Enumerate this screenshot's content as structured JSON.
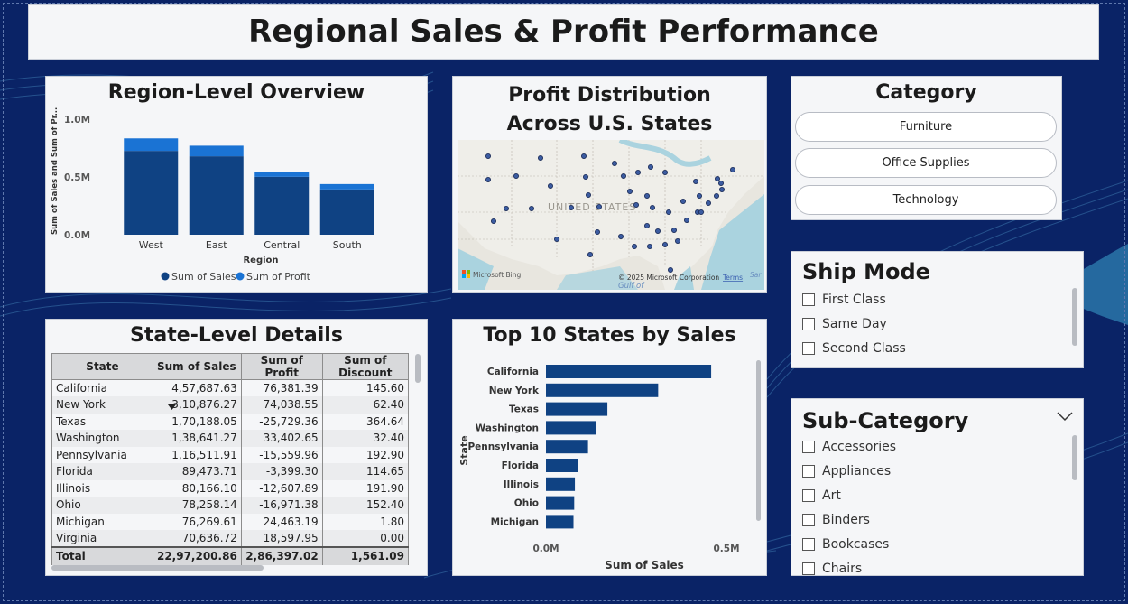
{
  "title": "Regional Sales & Profit Performance",
  "region_overview": {
    "title": "Region-Level Overview",
    "ylabel": "Sum of Sales and Sum of Pr...",
    "xlabel": "Region",
    "legend": [
      {
        "label": "Sum of Sales",
        "color": "#0f4283"
      },
      {
        "label": "Sum of Profit",
        "color": "#1a73d4"
      }
    ]
  },
  "map": {
    "title": "Profit Distribution Across U.S. States",
    "country_label": "UNITED STATES",
    "bing_label": "Microsoft Bing",
    "copyright": "© 2025 Microsoft Corporation",
    "terms": "Terms",
    "gulf_label": "Gulf of",
    "sar_label": "Sar"
  },
  "category": {
    "title": "Category",
    "options": [
      "Furniture",
      "Office Supplies",
      "Technology"
    ]
  },
  "ship_mode": {
    "title": "Ship Mode",
    "options": [
      "First Class",
      "Same Day",
      "Second Class"
    ]
  },
  "sub_category": {
    "title": "Sub-Category",
    "options": [
      "Accessories",
      "Appliances",
      "Art",
      "Binders",
      "Bookcases",
      "Chairs"
    ]
  },
  "state_details": {
    "title": "State-Level Details",
    "columns": [
      "State",
      "Sum of Sales",
      "Sum of Profit",
      "Sum of Discount"
    ],
    "rows": [
      [
        "California",
        "4,57,687.63",
        "76,381.39",
        "145.60"
      ],
      [
        "New York",
        "3,10,876.27",
        "74,038.55",
        "62.40"
      ],
      [
        "Texas",
        "1,70,188.05",
        "-25,729.36",
        "364.64"
      ],
      [
        "Washington",
        "1,38,641.27",
        "33,402.65",
        "32.40"
      ],
      [
        "Pennsylvania",
        "1,16,511.91",
        "-15,559.96",
        "192.90"
      ],
      [
        "Florida",
        "89,473.71",
        "-3,399.30",
        "114.65"
      ],
      [
        "Illinois",
        "80,166.10",
        "-12,607.89",
        "191.90"
      ],
      [
        "Ohio",
        "78,258.14",
        "-16,971.38",
        "152.40"
      ],
      [
        "Michigan",
        "76,269.61",
        "24,463.19",
        "1.80"
      ],
      [
        "Virginia",
        "70,636.72",
        "18,597.95",
        "0.00"
      ]
    ],
    "total": [
      "Total",
      "22,97,200.86",
      "2,86,397.02",
      "1,561.09"
    ]
  },
  "top10": {
    "title": "Top 10 States by Sales"
  },
  "chart_data": [
    {
      "type": "bar",
      "title": "Region-Level Overview",
      "xlabel": "Region",
      "ylabel": "Sum of Sales and Sum of Pr...",
      "categories": [
        "West",
        "East",
        "Central",
        "South"
      ],
      "series": [
        {
          "name": "Sum of Sales",
          "values": [
            725458,
            678781,
            501240,
            391722
          ],
          "color": "#0f4283"
        },
        {
          "name": "Sum of Profit",
          "values": [
            108418,
            91523,
            39706,
            46749
          ],
          "color": "#1a73d4"
        }
      ],
      "stacked": true,
      "ylim": [
        0,
        1000000
      ],
      "yticks": [
        "0.0M",
        "0.5M",
        "1.0M"
      ],
      "legend": "bottom"
    },
    {
      "type": "bar",
      "orientation": "horizontal",
      "title": "Top 10 States by Sales",
      "xlabel": "Sum of Sales",
      "ylabel": "State",
      "categories": [
        "California",
        "New York",
        "Texas",
        "Washington",
        "Pennsylvania",
        "Florida",
        "Illinois",
        "Ohio",
        "Michigan"
      ],
      "values": [
        457688,
        310876,
        170188,
        138641,
        116512,
        89474,
        80166,
        78258,
        76270
      ],
      "xlim": [
        0,
        550000
      ],
      "xticks": [
        "0.0M",
        "0.5M"
      ],
      "color": "#0f4283"
    }
  ]
}
